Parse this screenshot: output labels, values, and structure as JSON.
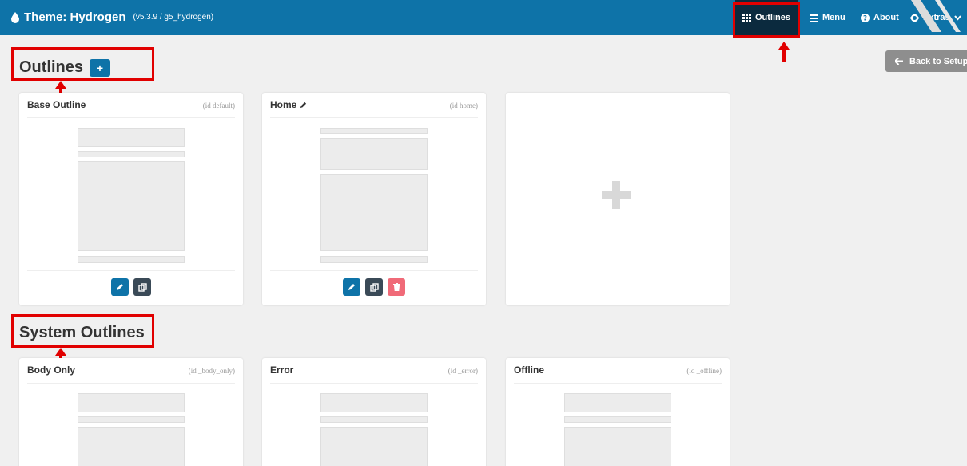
{
  "topbar": {
    "theme_label": "Theme: Hydrogen",
    "version": "(v5.3.9 / g5_hydrogen)",
    "nav": [
      {
        "label": "Outlines",
        "icon": "grid-icon",
        "active": true
      },
      {
        "label": "Menu",
        "icon": "bars-icon"
      },
      {
        "label": "About",
        "icon": "question-circle-icon"
      },
      {
        "label": "Extras",
        "icon": "gear-icon"
      }
    ]
  },
  "outlines": {
    "heading": "Outlines",
    "add_label": "+",
    "back_label": "Back to Setup",
    "cards": [
      {
        "title": "Base Outline",
        "id_text": "(id default)"
      },
      {
        "title": "Home",
        "id_text": "(id home)"
      }
    ]
  },
  "system": {
    "heading": "System Outlines",
    "cards": [
      {
        "title": "Body Only",
        "id_text": "(id _body_only)"
      },
      {
        "title": "Error",
        "id_text": "(id _error)"
      },
      {
        "title": "Offline",
        "id_text": "(id _offline)"
      }
    ]
  },
  "colors": {
    "topbar": "#0e73a8",
    "active_nav": "#0b2a3e",
    "annotation": "#e10000",
    "delete": "#f06a78"
  }
}
